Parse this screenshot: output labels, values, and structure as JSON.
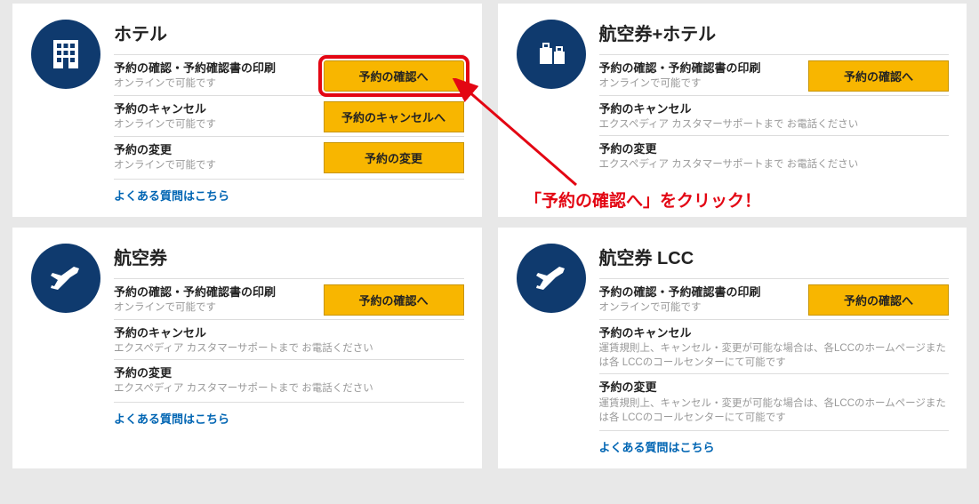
{
  "cards": [
    {
      "title": "ホテル",
      "rows": [
        {
          "label": "予約の確認・予約確認書の印刷",
          "sub": "オンラインで可能です",
          "btn": "予約の確認へ",
          "highlight": true
        },
        {
          "label": "予約のキャンセル",
          "sub": "オンラインで可能です",
          "btn": "予約のキャンセルへ"
        },
        {
          "label": "予約の変更",
          "sub": "オンラインで可能です",
          "btn": "予約の変更"
        }
      ],
      "faq": "よくある質問はこちら"
    },
    {
      "title": "航空券+ホテル",
      "rows": [
        {
          "label": "予約の確認・予約確認書の印刷",
          "sub": "オンラインで可能です",
          "btn": "予約の確認へ"
        },
        {
          "label": "予約のキャンセル",
          "sub": "エクスペディア カスタマーサポートまで お電話ください"
        },
        {
          "label": "予約の変更",
          "sub": "エクスペディア カスタマーサポートまで お電話ください"
        }
      ]
    },
    {
      "title": "航空券",
      "rows": [
        {
          "label": "予約の確認・予約確認書の印刷",
          "sub": "オンラインで可能です",
          "btn": "予約の確認へ"
        },
        {
          "label": "予約のキャンセル",
          "sub": "エクスペディア カスタマーサポートまで お電話ください"
        },
        {
          "label": "予約の変更",
          "sub": "エクスペディア カスタマーサポートまで お電話ください"
        }
      ],
      "faq": "よくある質問はこちら"
    },
    {
      "title": "航空券 LCC",
      "rows": [
        {
          "label": "予約の確認・予約確認書の印刷",
          "sub": "オンラインで可能です",
          "btn": "予約の確認へ"
        },
        {
          "label": "予約のキャンセル",
          "sub": "運賃規則上、キャンセル・変更が可能な場合は、各LCCのホームページまたは各 LCCのコールセンターにて可能です"
        },
        {
          "label": "予約の変更",
          "sub": "運賃規則上、キャンセル・変更が可能な場合は、各LCCのホームページまたは各 LCCのコールセンターにて可能です"
        }
      ],
      "faq": "よくある質問はこちら"
    }
  ],
  "annotation": "「予約の確認へ」をクリック！"
}
